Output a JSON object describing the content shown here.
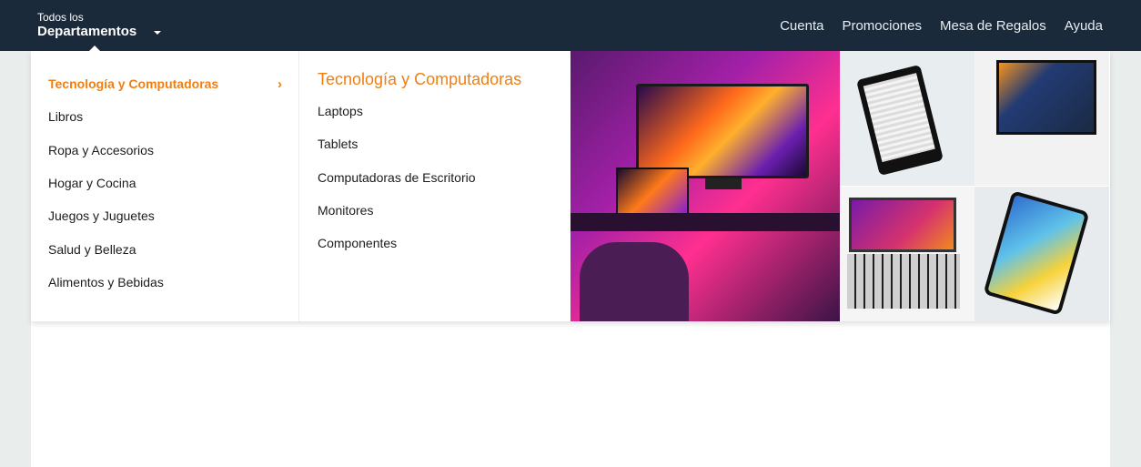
{
  "header": {
    "departments_line1": "Todos los",
    "departments_line2": "Departamentos",
    "nav": [
      "Cuenta",
      "Promociones",
      "Mesa de Regalos",
      "Ayuda"
    ]
  },
  "menu": {
    "categories": [
      "Tecnología y Computadoras",
      "Libros",
      "Ropa y Accesorios",
      "Hogar y Cocina",
      "Juegos y Juguetes",
      "Salud y Belleza",
      "Alimentos y Bebidas"
    ],
    "active_index": 0,
    "submenu_title": "Tecnología y Computadoras",
    "submenu_items": [
      "Laptops",
      "Tablets",
      "Computadoras de Escritorio",
      "Monitores",
      "Componentes"
    ]
  },
  "icons": {
    "dropdown": "chevron-down-icon",
    "active_category": "chevron-right-icon"
  },
  "colors": {
    "header_bg": "#1a2a3b",
    "accent": "#f07f12",
    "page_bg": "#e9eeed"
  }
}
